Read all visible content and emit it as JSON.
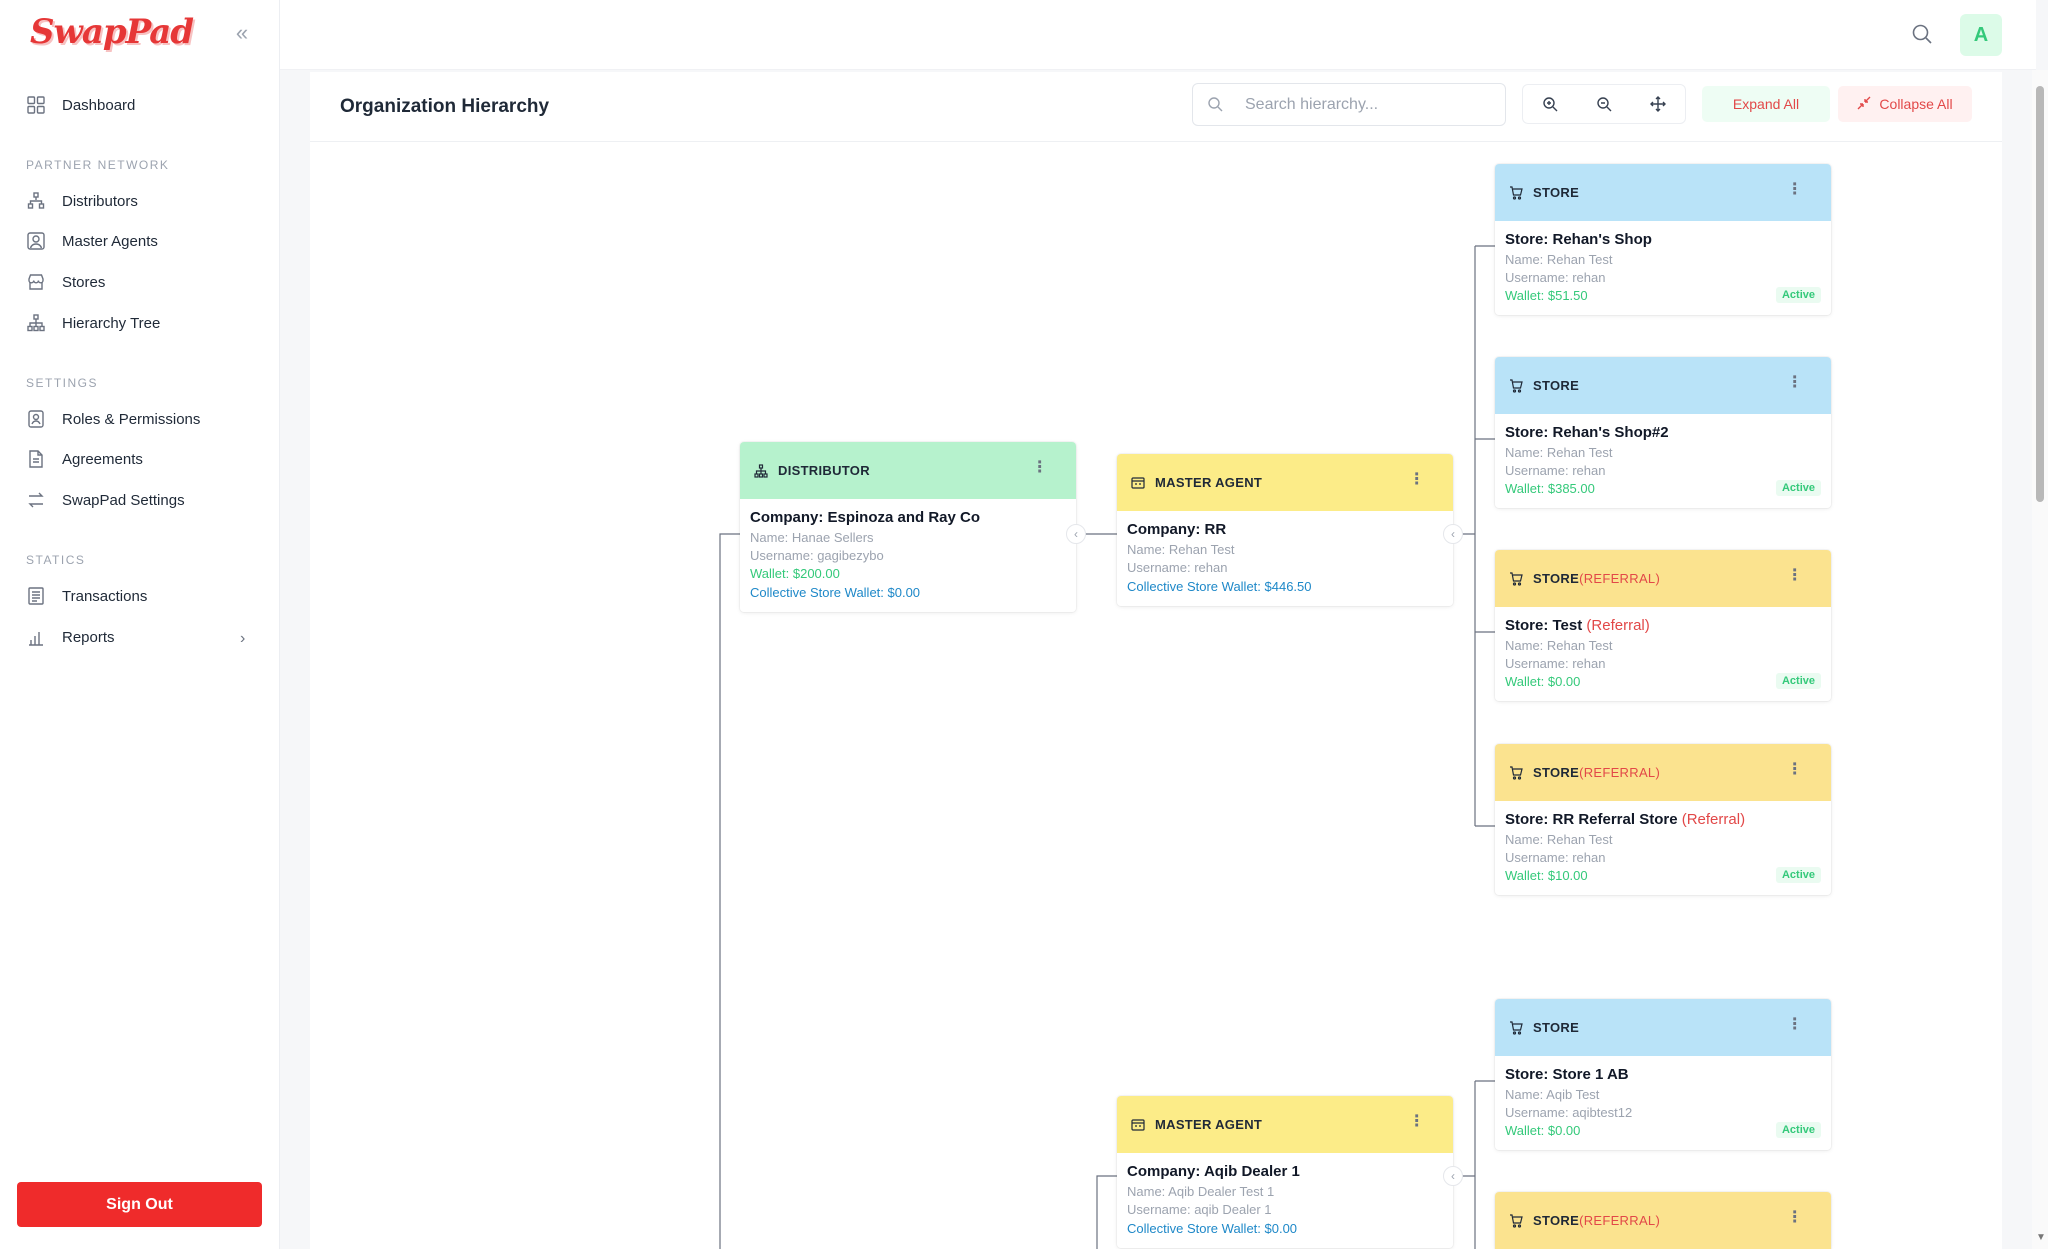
{
  "app": {
    "logo_text": "SwapPad"
  },
  "sidebar": {
    "dashboard": "Dashboard",
    "section_partner": "PARTNER NETWORK",
    "distributors": "Distributors",
    "master_agents": "Master Agents",
    "stores": "Stores",
    "hierarchy_tree": "Hierarchy Tree",
    "section_settings": "SETTINGS",
    "roles": "Roles & Permissions",
    "agreements": "Agreements",
    "swappad_settings": "SwapPad Settings",
    "section_statics": "STATICS",
    "transactions": "Transactions",
    "reports": "Reports",
    "sign_out": "Sign Out"
  },
  "topbar": {
    "avatar_letter": "A"
  },
  "header": {
    "title": "Organization Hierarchy",
    "search_placeholder": "Search hierarchy...",
    "expand_all": "Expand All",
    "collapse_all": "Collapse All"
  },
  "colors": {
    "brand": "#e63737",
    "accent_green": "#34c97a",
    "link_blue": "#1e88c8",
    "referral_red": "#e24848"
  },
  "nodes": {
    "distributor": {
      "type": "DISTRIBUTOR",
      "title": "Company: Espinoza and Ray Co",
      "name": "Name: Hanae Sellers",
      "username": "Username: gagibezybo",
      "wallet": "Wallet: $200.00",
      "collective": "Collective Store Wallet: $0.00"
    },
    "master1": {
      "type": "MASTER AGENT",
      "title": "Company: RR",
      "name": "Name: Rehan Test",
      "username": "Username: rehan",
      "collective": "Collective Store Wallet: $446.50"
    },
    "master2": {
      "type": "MASTER AGENT",
      "title": "Company: Aqib Dealer 1",
      "name": "Name: Aqib Dealer Test 1",
      "username": "Username: aqib Dealer 1",
      "collective": "Collective Store Wallet: $0.00"
    },
    "store1": {
      "type": "STORE",
      "title": "Store: Rehan's Shop",
      "name": "Name: Rehan Test",
      "username": "Username: rehan",
      "wallet": "Wallet: $51.50",
      "status": "Active"
    },
    "store2": {
      "type": "STORE",
      "title": "Store: Rehan's Shop#2",
      "name": "Name: Rehan Test",
      "username": "Username: rehan",
      "wallet": "Wallet: $385.00",
      "status": "Active"
    },
    "store3": {
      "type": "STORE",
      "type_suffix": "(REFERRAL)",
      "title": "Store: Test",
      "title_suffix": "(Referral)",
      "name": "Name: Rehan Test",
      "username": "Username: rehan",
      "wallet": "Wallet: $0.00",
      "status": "Active"
    },
    "store4": {
      "type": "STORE",
      "type_suffix": "(REFERRAL)",
      "title": "Store: RR Referral Store",
      "title_suffix": "(Referral)",
      "name": "Name: Rehan Test",
      "username": "Username: rehan",
      "wallet": "Wallet: $10.00",
      "status": "Active"
    },
    "store5": {
      "type": "STORE",
      "title": "Store: Store 1 AB",
      "name": "Name: Aqib Test",
      "username": "Username: aqibtest12",
      "wallet": "Wallet: $0.00",
      "status": "Active"
    },
    "store6": {
      "type": "STORE",
      "type_suffix": "(REFERRAL)"
    }
  }
}
